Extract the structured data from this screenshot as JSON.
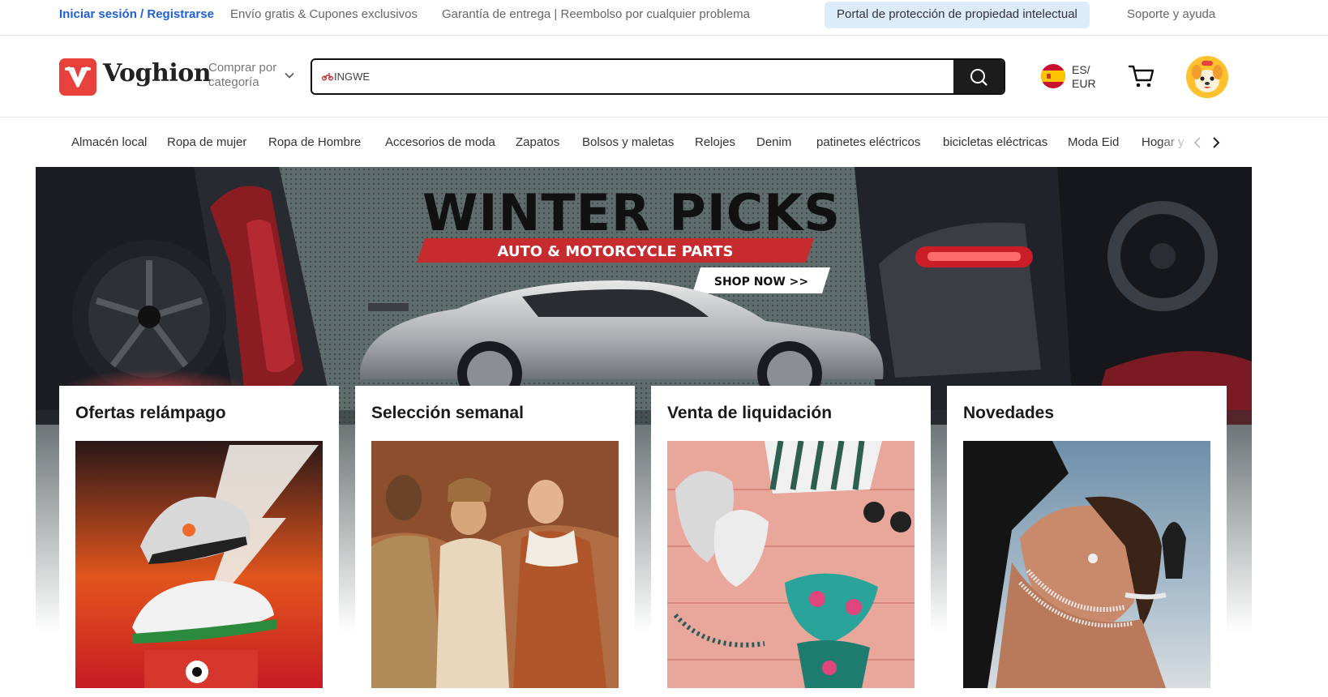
{
  "topbar": {
    "login": "Iniciar sesión / Registrarse",
    "shipping": "Envío gratis & Cupones exclusivos",
    "guarantee": "Garantía de entrega | Reembolso por cualquier problema",
    "ip_portal": "Portal de protección de propiedad intelectual",
    "help": "Soporte y ayuda"
  },
  "header": {
    "brand": "Voghion",
    "category_label": "Comprar por categoría",
    "search_value": "INGWE",
    "language": "ES/",
    "currency": "EUR"
  },
  "category_nav": [
    "Almacén local",
    "Ropa de mujer",
    "Ropa de Hombre",
    "Accesorios de moda",
    "Zapatos",
    "Bolsos y maletas",
    "Relojes",
    "Denim",
    "patinetes eléctricos",
    "bicicletas eléctricas",
    "Moda Eid",
    "Hogar y"
  ],
  "banner": {
    "headline": "WINTER PICKS",
    "subline": "AUTO & MOTORCYCLE PARTS",
    "cta": "SHOP NOW >>"
  },
  "cards": [
    {
      "title": "Ofertas relámpago"
    },
    {
      "title": "Selección semanal"
    },
    {
      "title": "Venta de liquidación"
    },
    {
      "title": "Novedades"
    }
  ],
  "colors": {
    "brand_red": "#e8403b",
    "link_blue": "#1f5fd6",
    "ip_badge_bg": "#dcecfb",
    "search_button": "#1c1c1c"
  }
}
